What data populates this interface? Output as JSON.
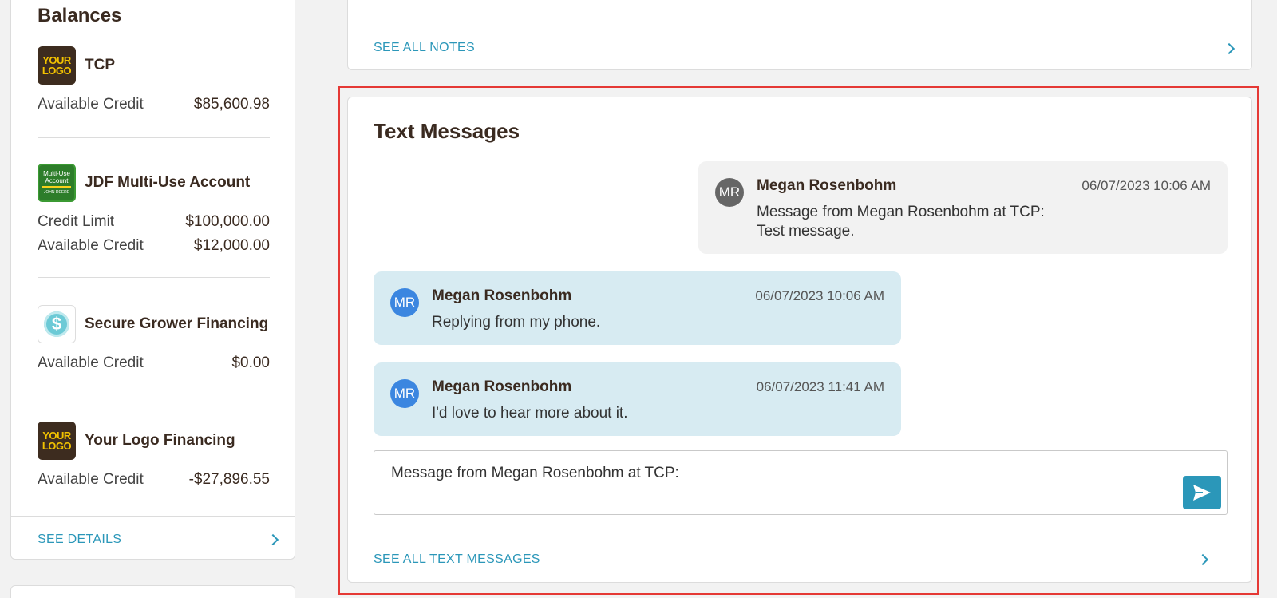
{
  "balances": {
    "title": "Balances",
    "accounts": [
      {
        "name": "TCP",
        "logo": "your-logo",
        "logo_text": "YOUR LOGO",
        "rows": [
          {
            "label": "Available Credit",
            "value": "$85,600.98"
          }
        ]
      },
      {
        "name": "JDF Multi-Use Account",
        "logo": "john-deere-multi-use",
        "logo_text": "Multi-Use Account",
        "logo_subtext": "JOHN DEERE",
        "rows": [
          {
            "label": "Credit Limit",
            "value": "$100,000.00"
          },
          {
            "label": "Available Credit",
            "value": "$12,000.00"
          }
        ]
      },
      {
        "name": "Secure Grower Financing",
        "logo": "dollar-coin",
        "logo_text": "$",
        "rows": [
          {
            "label": "Available Credit",
            "value": "$0.00"
          }
        ]
      },
      {
        "name": "Your Logo Financing",
        "logo": "your-logo",
        "logo_text": "YOUR LOGO",
        "rows": [
          {
            "label": "Available Credit",
            "value": "-$27,896.55"
          }
        ]
      }
    ],
    "see_details": "SEE DETAILS"
  },
  "notes": {
    "see_all": "SEE ALL NOTES"
  },
  "text_messages": {
    "title": "Text Messages",
    "messages": [
      {
        "direction": "outgoing",
        "initials": "MR",
        "sender": "Megan Rosenbohm",
        "timestamp": "06/07/2023 10:06 AM",
        "line1": "Message from Megan Rosenbohm at TCP:",
        "line2": "Test message."
      },
      {
        "direction": "incoming",
        "initials": "MR",
        "sender": "Megan Rosenbohm",
        "timestamp": "06/07/2023 10:06 AM",
        "line1": "Replying from my phone."
      },
      {
        "direction": "incoming",
        "initials": "MR",
        "sender": "Megan Rosenbohm",
        "timestamp": "06/07/2023 11:41 AM",
        "line1": "I'd love to hear more about it."
      }
    ],
    "compose_value": "Message from Megan Rosenbohm at TCP:",
    "send_icon": "send-icon",
    "see_all": "SEE ALL TEXT MESSAGES"
  },
  "colors": {
    "accent": "#2b97b9",
    "highlight_border": "#e53935",
    "incoming_bubble": "#d7ebf2",
    "outgoing_bubble": "#f2f2f2",
    "avatar_outgoing": "#666666",
    "avatar_incoming": "#3b86e0"
  }
}
